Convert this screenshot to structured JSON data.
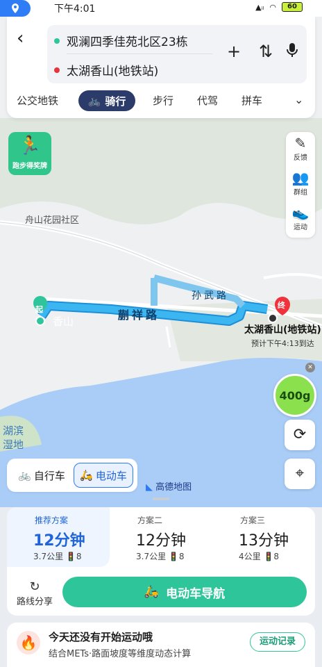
{
  "status_bar": {
    "time": "下午4:01",
    "battery": "60"
  },
  "search": {
    "origin": "观澜四季佳苑北区23栋",
    "destination": "太湖香山(地铁站)",
    "back_label": "‹",
    "add_icon": "plus-icon",
    "swap_icon": "swap-icon",
    "voice_icon": "microphone-icon"
  },
  "mode_tabs": {
    "transit": "公交地铁",
    "cycling": "骑行",
    "walking": "步行",
    "chauffeur": "代驾",
    "carpool": "拼车"
  },
  "map": {
    "badge_label": "跑步得奖牌",
    "poi_community": "舟山花园社区",
    "road1": "蒯祥路",
    "road2": "孙武路",
    "start_marker": "起",
    "start_area": "香山",
    "end_marker": "终",
    "destination_label": "太湖香山(地铁站)",
    "eta": "预计下午4:13到达",
    "lake_label": "湖滨湿地",
    "eco_value": "400g",
    "brand": "高德地图"
  },
  "side_tools": {
    "feedback": "反馈",
    "group": "群组",
    "sport": "运动"
  },
  "vehicle": {
    "bike": "自行车",
    "ebike": "电动车"
  },
  "plans": [
    {
      "title": "推荐方案",
      "duration": "12分钟",
      "distance": "3.7公里",
      "lights": "8"
    },
    {
      "title": "方案二",
      "duration": "12分钟",
      "distance": "3.7公里",
      "lights": "8"
    },
    {
      "title": "方案三",
      "duration": "13分钟",
      "distance": "4公里",
      "lights": "8"
    }
  ],
  "actions": {
    "share": "路线分享",
    "navigate": "电动车导航"
  },
  "sport_card": {
    "title": "今天还没有开始运动哦",
    "subtitle": "结合METs·路面坡度等维度动态计算",
    "record": "运动记录"
  },
  "colors": {
    "route": "#21a6e8",
    "primary": "#1f64d8",
    "nav_button": "#2ec59a",
    "active_tab": "#2b3c6b"
  }
}
